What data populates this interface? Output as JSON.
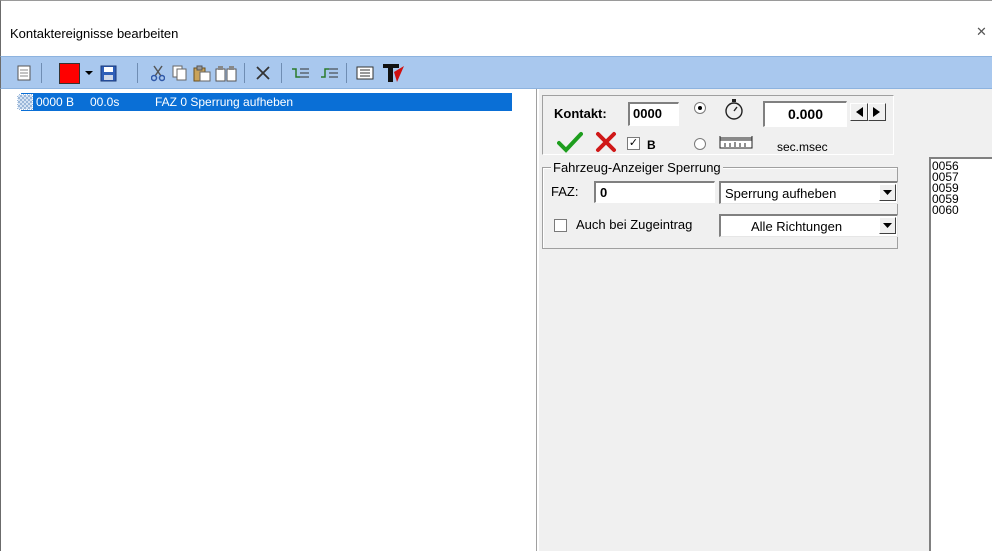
{
  "window": {
    "title": "Kontaktereignisse bearbeiten",
    "close_glyph": "✕"
  },
  "toolbar": {
    "buttons": [
      {
        "name": "new-document-icon"
      },
      {
        "name": "color-swatch",
        "color": "#ff0000"
      },
      {
        "name": "color-dropdown-icon"
      },
      {
        "name": "save-icon"
      },
      {
        "name": "cut-icon"
      },
      {
        "name": "copy-icon"
      },
      {
        "name": "paste-icon"
      },
      {
        "name": "paste-special-icon"
      },
      {
        "name": "delete-icon"
      },
      {
        "name": "insert-before-icon"
      },
      {
        "name": "insert-after-icon"
      },
      {
        "name": "table-view-icon"
      },
      {
        "name": "text-tool-icon"
      }
    ]
  },
  "events": [
    {
      "contact": "0000 B",
      "time": "00.0s",
      "description": "FAZ 0 Sperrung aufheben"
    }
  ],
  "kontakt": {
    "label": "Kontakt:",
    "value": "0000",
    "b_label": "B",
    "b_checked": true,
    "time_value": "0.000",
    "unit": "sec.msec",
    "time_mode": "timer"
  },
  "group": {
    "title": "Fahrzeug-Anzeiger Sperrung",
    "faz_label": "FAZ:",
    "faz_value": "0",
    "action_value": "Sperrung aufheben",
    "zugeintrag_label": "Auch bei Zugeintrag",
    "zugeintrag_checked": false,
    "direction_value": "Alle Richtungen"
  },
  "id_list": [
    "0056",
    "0057",
    "0059",
    "0059",
    "0060"
  ]
}
